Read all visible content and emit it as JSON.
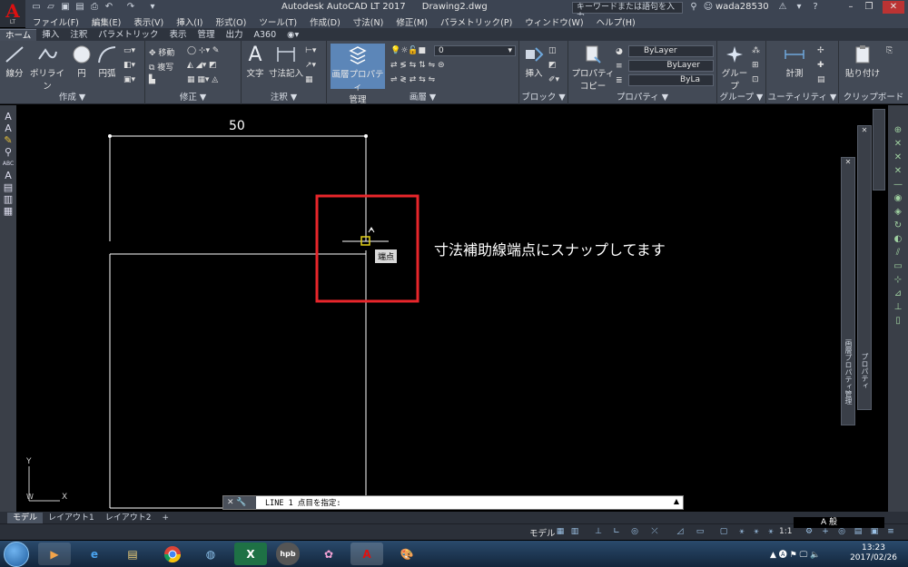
{
  "app": {
    "logo_text": "A",
    "logo_sub": "LT",
    "title": "Autodesk AutoCAD LT 2017",
    "file": "Drawing2.dwg",
    "search_placeholder": "キーワードまたは語句を入力",
    "user": "wada28530"
  },
  "menu": [
    "ファイル(F)",
    "編集(E)",
    "表示(V)",
    "挿入(I)",
    "形式(O)",
    "ツール(T)",
    "作成(D)",
    "寸法(N)",
    "修正(M)",
    "パラメトリック(P)",
    "ウィンドウ(W)",
    "ヘルプ(H)"
  ],
  "ribbon_tabs": [
    {
      "label": "ホーム",
      "active": true
    },
    {
      "label": "挿入"
    },
    {
      "label": "注釈"
    },
    {
      "label": "パラメトリック"
    },
    {
      "label": "表示"
    },
    {
      "label": "管理"
    },
    {
      "label": "出力"
    },
    {
      "label": "A360"
    }
  ],
  "panels": {
    "draw": {
      "title": "作成 ▼",
      "line": "線分",
      "polyline": "ポリライン",
      "circle": "円",
      "arc": "円弧"
    },
    "modify": {
      "title": "修正 ▼",
      "move": "移動",
      "copy": "複写"
    },
    "annotation": {
      "title": "注釈 ▼",
      "text": "文字",
      "dimension": "寸法記入"
    },
    "layers": {
      "title": "画層 ▼",
      "layer_props_line1": "画層プロパティ",
      "layer_props_line2": "管理",
      "current_layer": "0"
    },
    "block": {
      "title": "ブロック ▼",
      "insert": "挿入"
    },
    "properties": {
      "title": "プロパティ ▼",
      "match_line1": "プロパティ",
      "match_line2": "コピー",
      "color": "ByLayer",
      "linetype": "ByLayer",
      "lineweight": "ByLa"
    },
    "groups": {
      "title": "グループ ▼",
      "group": "グループ"
    },
    "utilities": {
      "title": "ユーティリティ ▼",
      "measure": "計測"
    },
    "clipboard": {
      "title": "クリップボード",
      "paste": "貼り付け"
    }
  },
  "drawing": {
    "dimension_value": "50",
    "annotation": "寸法補助線端点にスナップしてます",
    "snap_tooltip": "端点",
    "ucs_y": "Y",
    "ucs_x": "X",
    "ucs_w": "W"
  },
  "palettes": {
    "layer_props": "画層プロパティ管理",
    "properties": "プロパティ"
  },
  "command_line": {
    "text": "LINE 1 点目を指定:"
  },
  "layout_tabs": [
    {
      "label": "モデル",
      "active": true
    },
    {
      "label": "レイアウト1"
    },
    {
      "label": "レイアウト2"
    },
    {
      "label": "+"
    }
  ],
  "status": {
    "model": "モデル",
    "scale": "1:1"
  },
  "tray": {
    "ime": "A 般",
    "time": "13:23",
    "date": "2017/02/26"
  },
  "colors": {
    "highlight_box": "#e8262b",
    "snap_marker": "#e5d31a",
    "accent": "#6fa8dc"
  }
}
